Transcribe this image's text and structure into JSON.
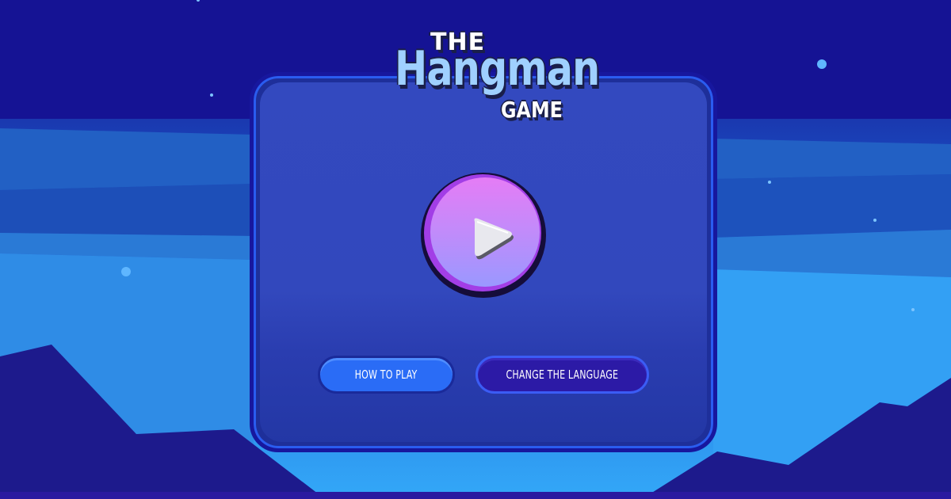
{
  "title": {
    "the": "THE",
    "main": "Hangman",
    "game": "GAME"
  },
  "buttons": {
    "play_icon": "play-triangle-icon",
    "how_to_play": "HOW TO PLAY",
    "change_language": "CHANGE THE LANGUAGE"
  },
  "colors": {
    "sky_top": "#13128a",
    "sky_bottom": "#33a8f8",
    "card": "#3349bf",
    "accent_blue": "#2a6cf6",
    "accent_purple": "#2c1aa6",
    "play_top": "#e57cf6",
    "play_bottom": "#9a98ff",
    "logo_text": "#9fd0ff"
  }
}
